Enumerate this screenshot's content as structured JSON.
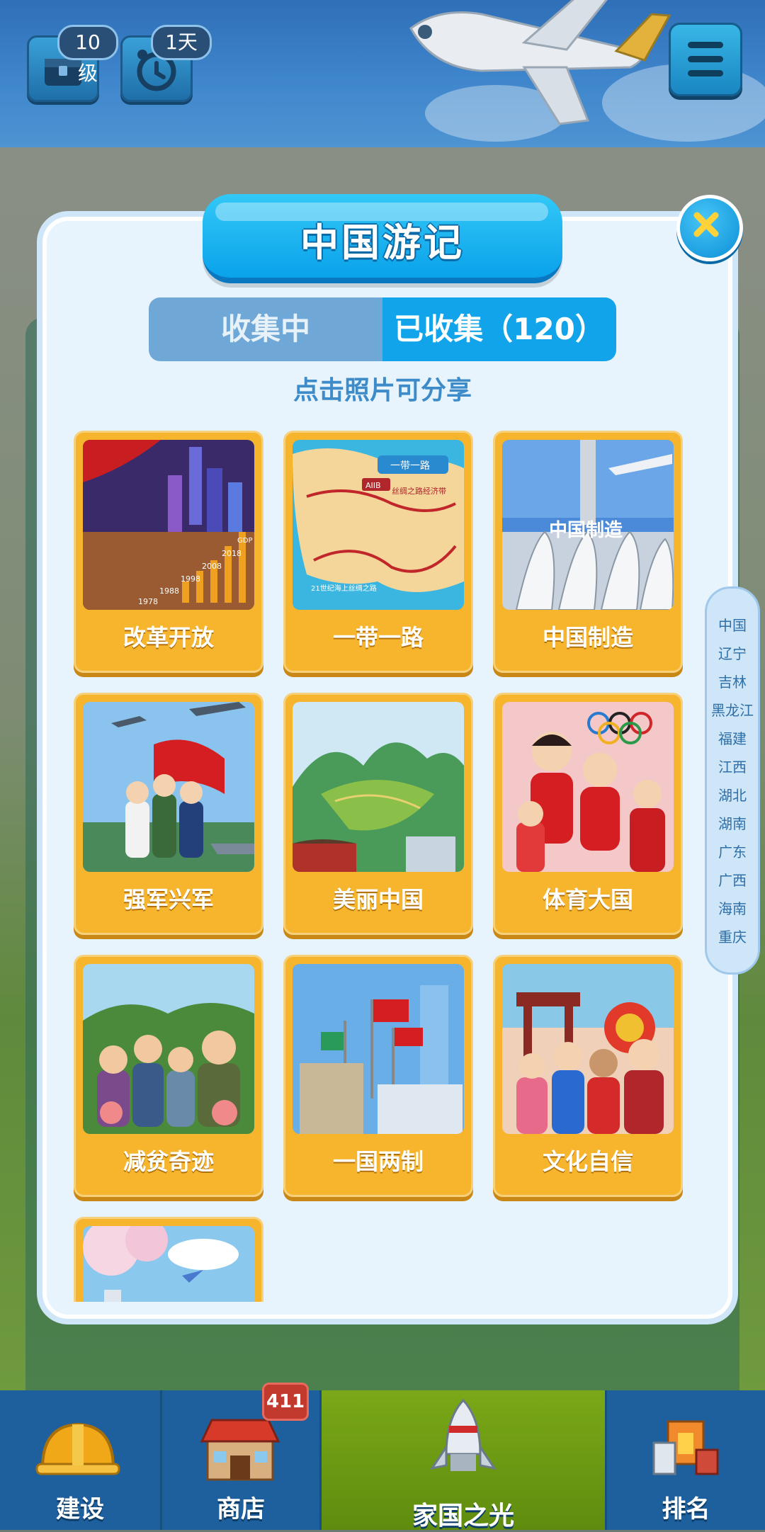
{
  "hud": {
    "level_badge": "10级",
    "days_badge": "1天"
  },
  "modal": {
    "title": "中国游记",
    "tabs": [
      "收集中",
      "已收集（120）"
    ],
    "active_tab": 1,
    "hint": "点击照片可分享",
    "cards": [
      {
        "label": "改革开放",
        "icon": "reform-opening-image"
      },
      {
        "label": "一带一路",
        "icon": "belt-and-road-map-image"
      },
      {
        "label": "中国制造",
        "icon": "made-in-china-image"
      },
      {
        "label": "强军兴军",
        "icon": "military-image"
      },
      {
        "label": "美丽中国",
        "icon": "beautiful-china-landscape-image"
      },
      {
        "label": "体育大国",
        "icon": "sports-olympics-image"
      },
      {
        "label": "减贫奇迹",
        "icon": "poverty-alleviation-image"
      },
      {
        "label": "一国两制",
        "icon": "one-country-two-systems-image"
      },
      {
        "label": "文化自信",
        "icon": "cultural-confidence-image"
      },
      {
        "label": "",
        "icon": "cherry-blossom-image"
      }
    ],
    "image_text": {
      "reform_years": [
        "1978",
        "1988",
        "1998",
        "2008",
        "2018",
        "GDP"
      ],
      "belt_road_banner": "一带一路",
      "silk_road": "丝绸之路经济带",
      "maritime_road": "21世纪海上丝绸之路",
      "aiib": "AIIB",
      "made_in_china": "中国制造"
    }
  },
  "side_index": [
    "中国",
    "辽宁",
    "吉林",
    "黑龙江",
    "福建",
    "江西",
    "湖北",
    "湖南",
    "广东",
    "广西",
    "海南",
    "重庆"
  ],
  "bottom_nav": {
    "items": [
      "建设",
      "商店",
      "家国之光",
      "排名"
    ],
    "shop_badge": "411",
    "active": 2
  },
  "colors": {
    "accent": "#12a4ea",
    "card": "#f6b52c",
    "modal_bg": "#e8f4fd",
    "nav_bg": "#1e5f9e",
    "nav_active": "#6f9a12"
  }
}
